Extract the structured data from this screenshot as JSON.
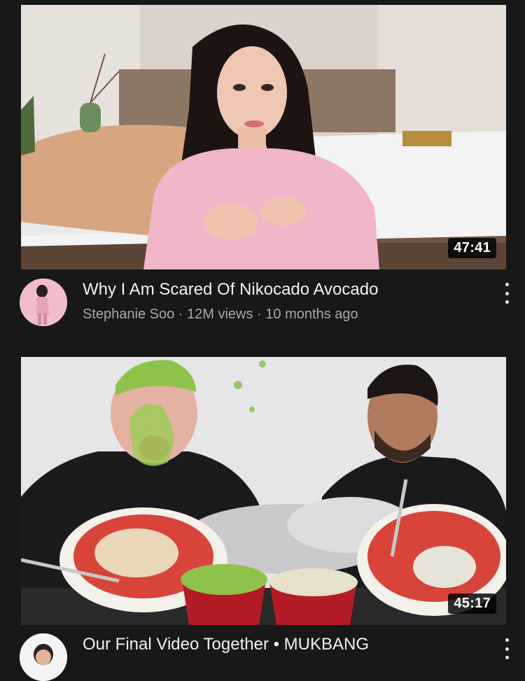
{
  "videos": [
    {
      "duration": "47:41",
      "title": "Why I Am Scared Of Nikocado Avocado",
      "channel": "Stephanie Soo",
      "views": "12M views",
      "age": "10 months ago",
      "menu_icon": "more-vert-icon"
    },
    {
      "duration": "45:17",
      "title": "Our Final Video Together • MUKBANG",
      "menu_icon": "more-vert-icon"
    }
  ],
  "meta_separator": " · ",
  "colors": {
    "background": "#181818",
    "title_text": "#f1f1f1",
    "meta_text": "#a8a8a8",
    "duration_badge": "#000000"
  }
}
